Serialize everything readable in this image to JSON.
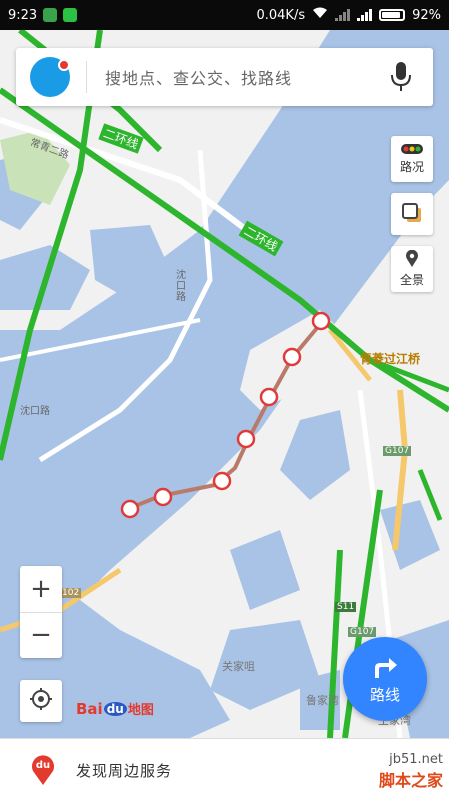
{
  "status": {
    "time": "9:23",
    "speed": "0.04K/s",
    "battery": "92%"
  },
  "search": {
    "placeholder": "搜地点、查公交、找路线"
  },
  "tools": {
    "traffic": "路况",
    "panorama": "全景"
  },
  "zoom": {
    "in": "+",
    "out": "−"
  },
  "logo": {
    "bai": "Bai",
    "du": "du",
    "map": "地图"
  },
  "route_button": {
    "label": "路线"
  },
  "bottom": {
    "label": "发现周边服务",
    "icon_text": "du"
  },
  "map_labels": {
    "ring_road_1": "二环线",
    "ring_road_2": "二环线",
    "bridge": "青菱过江桥",
    "road_changqing": "常青二路",
    "road_shakou_v": "沈口路",
    "road_shakou_h": "沈口路",
    "g107_a": "G107",
    "g107_b": "G107",
    "s11": "S11",
    "g102": "102",
    "island": "关家咀",
    "village": "鲁家湾",
    "village2": "王家湾"
  },
  "watermark": {
    "url": "jb51.net",
    "name": "脚本之家"
  },
  "colors": {
    "accent": "#3385ff",
    "water": "#a9c3e6",
    "land": "#f1f1f1",
    "green_road": "#2db52d",
    "yellow_road": "#f6c86c",
    "route": "#b97a6a"
  }
}
